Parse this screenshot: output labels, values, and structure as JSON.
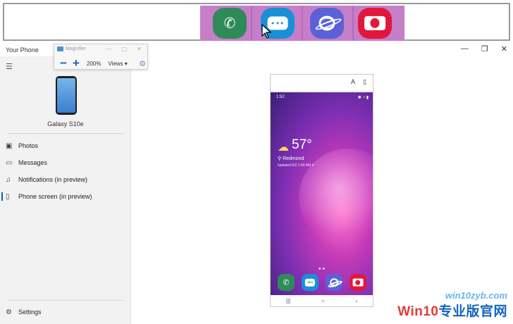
{
  "window": {
    "title": "Your Phone",
    "minimize": "—",
    "maximize": "❐",
    "close": "✕"
  },
  "magnifier": {
    "title": "Magnifier",
    "zoom_out": "−",
    "zoom_in": "+",
    "zoom_level": "200%",
    "views_label": "Views ▾",
    "settings_icon": "⚙",
    "minimize": "—",
    "maximize": "▢",
    "close": "✕"
  },
  "sidebar": {
    "menu_icon": "☰",
    "device_name": "Galaxy S10e",
    "items": [
      {
        "label": "Photos",
        "icon": "▣"
      },
      {
        "label": "Messages",
        "icon": "▭"
      },
      {
        "label": "Notifications (in preview)",
        "icon": "♫"
      },
      {
        "label": "Phone screen (in preview)",
        "icon": "▯"
      }
    ],
    "settings_label": "Settings",
    "settings_icon": "⚙"
  },
  "phone": {
    "top_icon_left": "A",
    "top_icon_right": "▯",
    "status_time": "1:52",
    "status_icons": "✱ ◔ ▮",
    "temperature": "57°",
    "location": "⚲ Redmond",
    "updated": "Updated 5/2 1:49 AM ↻",
    "page_dots": "●●",
    "nav_recent": "|||",
    "nav_home": "○",
    "nav_back": "‹"
  },
  "apps": {
    "phone_glyph": "✆",
    "phone_color": "#2e8b57",
    "messages_color": "#1a8fd6",
    "internet_color": "#5b61d8",
    "camera_color": "#e2173c"
  },
  "watermark": {
    "top": "win10zyb.com",
    "bottom_prefix": "Win10",
    "bottom_suffix": "专业版官网"
  }
}
